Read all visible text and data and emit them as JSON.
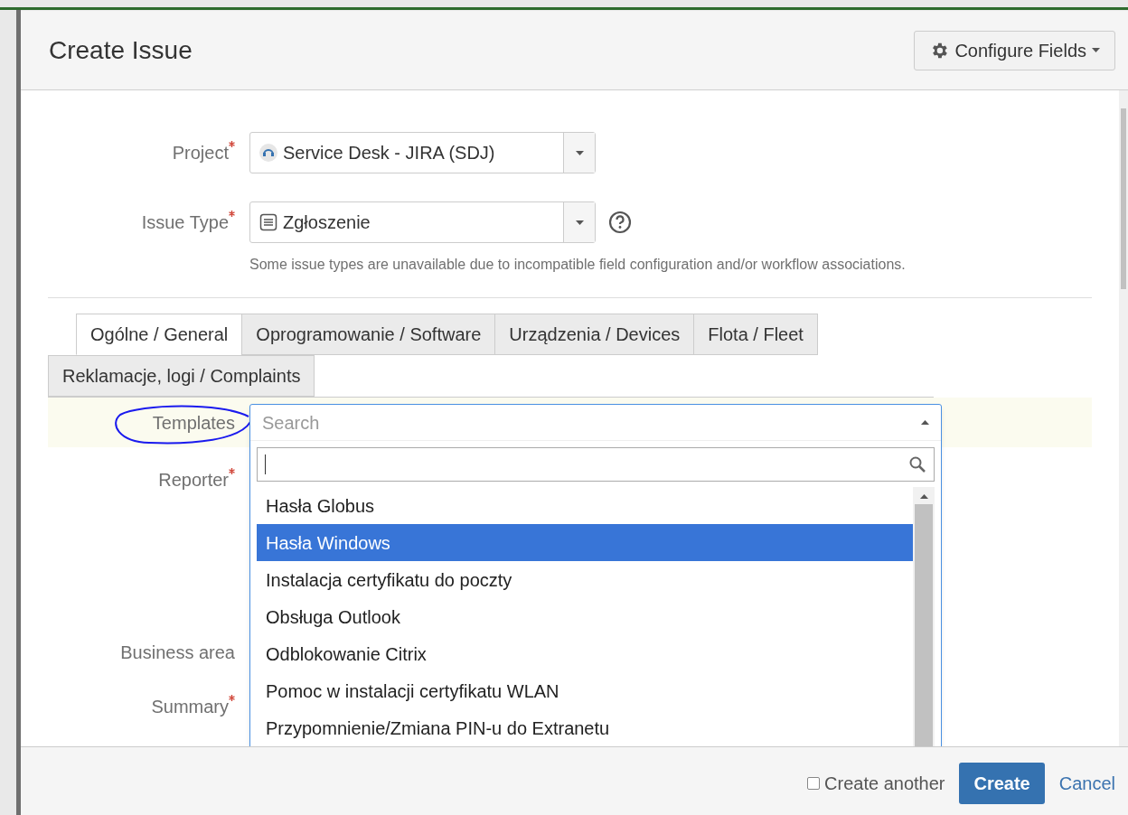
{
  "dialog": {
    "title": "Create Issue",
    "configure_button": "Configure Fields"
  },
  "fields": [
    {
      "label": "Project",
      "required": true,
      "value": "Service Desk - JIRA (SDJ)",
      "help": false
    },
    {
      "label": "Issue Type",
      "required": true,
      "value": "Zgłoszenie",
      "help": true,
      "note": "Some issue types are unavailable due to incompatible field configuration and/or workflow associations."
    }
  ],
  "tabs": [
    {
      "label": "Ogólne / General",
      "selected": true
    },
    {
      "label": "Oprogramowanie / Software",
      "selected": false
    },
    {
      "label": "Urządzenia / Devices",
      "selected": false
    },
    {
      "label": "Flota / Fleet",
      "selected": false
    },
    {
      "label": "Reklamacje, logi / Complaints",
      "selected": false
    }
  ],
  "templates": {
    "label": "Templates",
    "placeholder": "Search",
    "options": [
      {
        "label": "Hasła Globus",
        "selected": false
      },
      {
        "label": "Hasła Windows",
        "selected": true
      },
      {
        "label": "Instalacja certyfikatu do poczty",
        "selected": false
      },
      {
        "label": "Obsługa Outlook",
        "selected": false
      },
      {
        "label": "Odblokowanie Citrix",
        "selected": false
      },
      {
        "label": "Pomoc w instalacji certyfikatu WLAN",
        "selected": false
      },
      {
        "label": "Przypomnienie/Zmiana PIN-u do Extranetu",
        "selected": false
      }
    ]
  },
  "other_fields": [
    {
      "label": "Reporter",
      "required": true
    },
    {
      "label": "Business area",
      "required": false
    },
    {
      "label": "Summary",
      "required": true
    }
  ],
  "footer": {
    "create_another": {
      "label": "Create another",
      "checked": false
    },
    "create": "Create",
    "cancel": "Cancel"
  }
}
